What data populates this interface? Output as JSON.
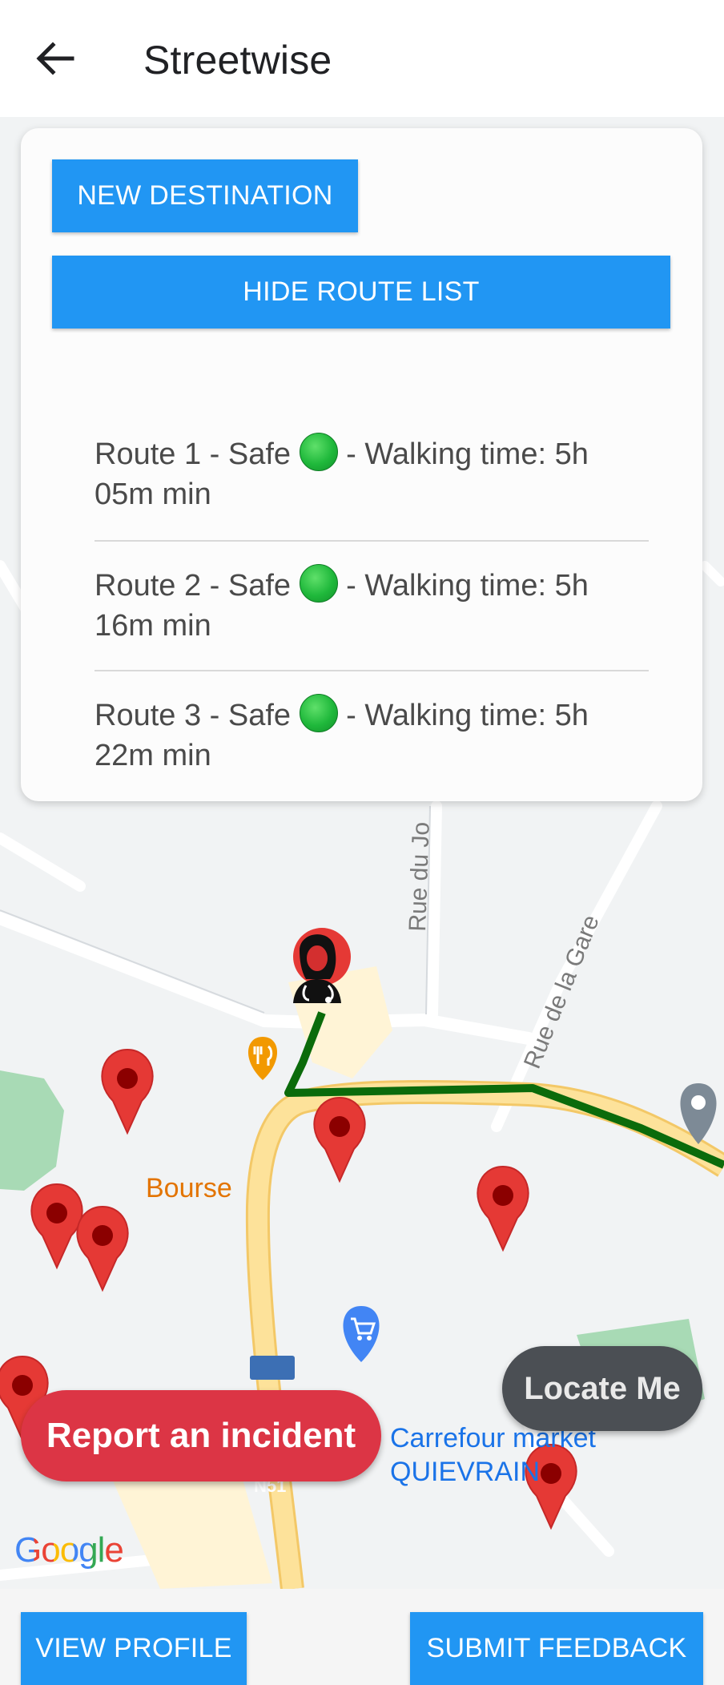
{
  "app": {
    "title": "Streetwise",
    "back_icon": "arrow-left-icon"
  },
  "route_panel": {
    "new_destination_label": "NEW DESTINATION",
    "hide_route_list_label": "HIDE ROUTE LIST",
    "routes": [
      {
        "prefix": "Route 1 - Safe",
        "status_icon": "green-circle-icon",
        "suffix": "- Walking time: 5h 05m min"
      },
      {
        "prefix": "Route 2 - Safe",
        "status_icon": "green-circle-icon",
        "suffix": "- Walking time: 5h 16m min"
      },
      {
        "prefix": "Route 3 - Safe",
        "status_icon": "green-circle-icon",
        "suffix": "- Walking time: 5h 22m min"
      }
    ]
  },
  "map": {
    "street_labels": [
      "Rue du Jo",
      "Rue de la Gare"
    ],
    "poi_labels": {
      "restaurant": "Bourse",
      "store_line1": "Carrefour market",
      "store_line2": "QUIEVRAIN",
      "road_shield": "N51"
    },
    "attribution": "Google",
    "route_color": "#0b6b0b",
    "marker_color": "#e53935"
  },
  "actions": {
    "report_incident_label": "Report an incident",
    "locate_me_label": "Locate Me",
    "view_profile_label": "VIEW PROFILE",
    "submit_feedback_label": "SUBMIT FEEDBACK"
  }
}
